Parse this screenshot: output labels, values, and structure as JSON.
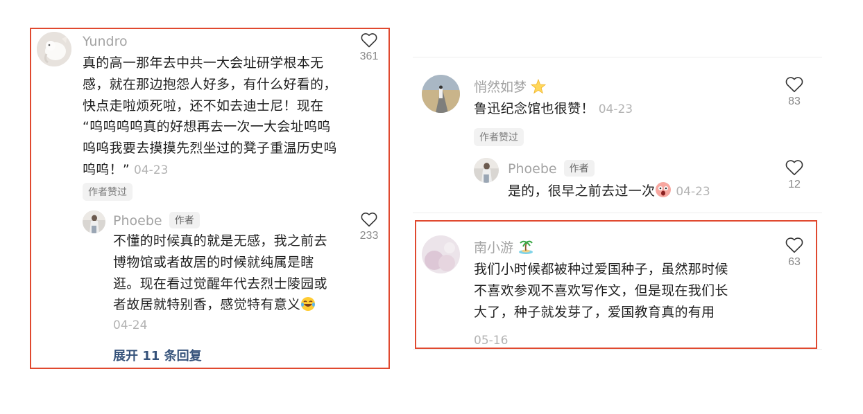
{
  "left": {
    "comment": {
      "username": "Yundro",
      "lines": [
        "真的高一那年去中共一大会址研学根本无",
        "感，就在那边抱怨人好多，有什么好看的，",
        "快点走啦烦死啦，还不如去迪士尼！现在",
        "“呜呜呜呜真的好想再去一次一大会址呜呜",
        "呜呜我要去摸摸先烈坐过的凳子重温历史呜",
        "呜呜！”"
      ],
      "date": "04-23",
      "liked_by_author": "作者赞过",
      "likes": "361"
    },
    "reply": {
      "username": "Phoebe",
      "author_tag": "作者",
      "lines": [
        "不懂的时候真的就是无感，我之前去",
        "博物馆或者故居的时候就纯属是瞎",
        "逛。现在看过觉醒年代去烈士陵园或",
        "者故居就特别香，感觉特有意义"
      ],
      "emoji": "laughing-tears-emoji",
      "date": "04-24",
      "likes": "233"
    },
    "expand_replies": "展开 11 条回复"
  },
  "right": {
    "comment1": {
      "username": "悄然如梦",
      "badge": "star-badge",
      "text": "鲁迅纪念馆也很赞！",
      "date": "04-23",
      "liked_by_author": "作者赞过",
      "likes": "83"
    },
    "reply1": {
      "username": "Phoebe",
      "author_tag": "作者",
      "text": "是的，很早之前去过一次",
      "emoji": "shocked-face-emoji",
      "date": "04-23",
      "likes": "12"
    },
    "comment2": {
      "username": "南小游",
      "badge": "palm-island-badge",
      "lines": [
        "我们小时候都被种过爱国种子，虽然那时候",
        "不喜欢参观不喜欢写作文，但是现在我们长",
        "大了，种子就发芽了，爱国教育真的有用"
      ],
      "date": "05-16",
      "likes": "63"
    }
  },
  "colors": {
    "highlight_border": "#e0492f",
    "username": "#a3a3a3",
    "body_text": "#1f1f1f",
    "expand_link": "#35527a"
  }
}
